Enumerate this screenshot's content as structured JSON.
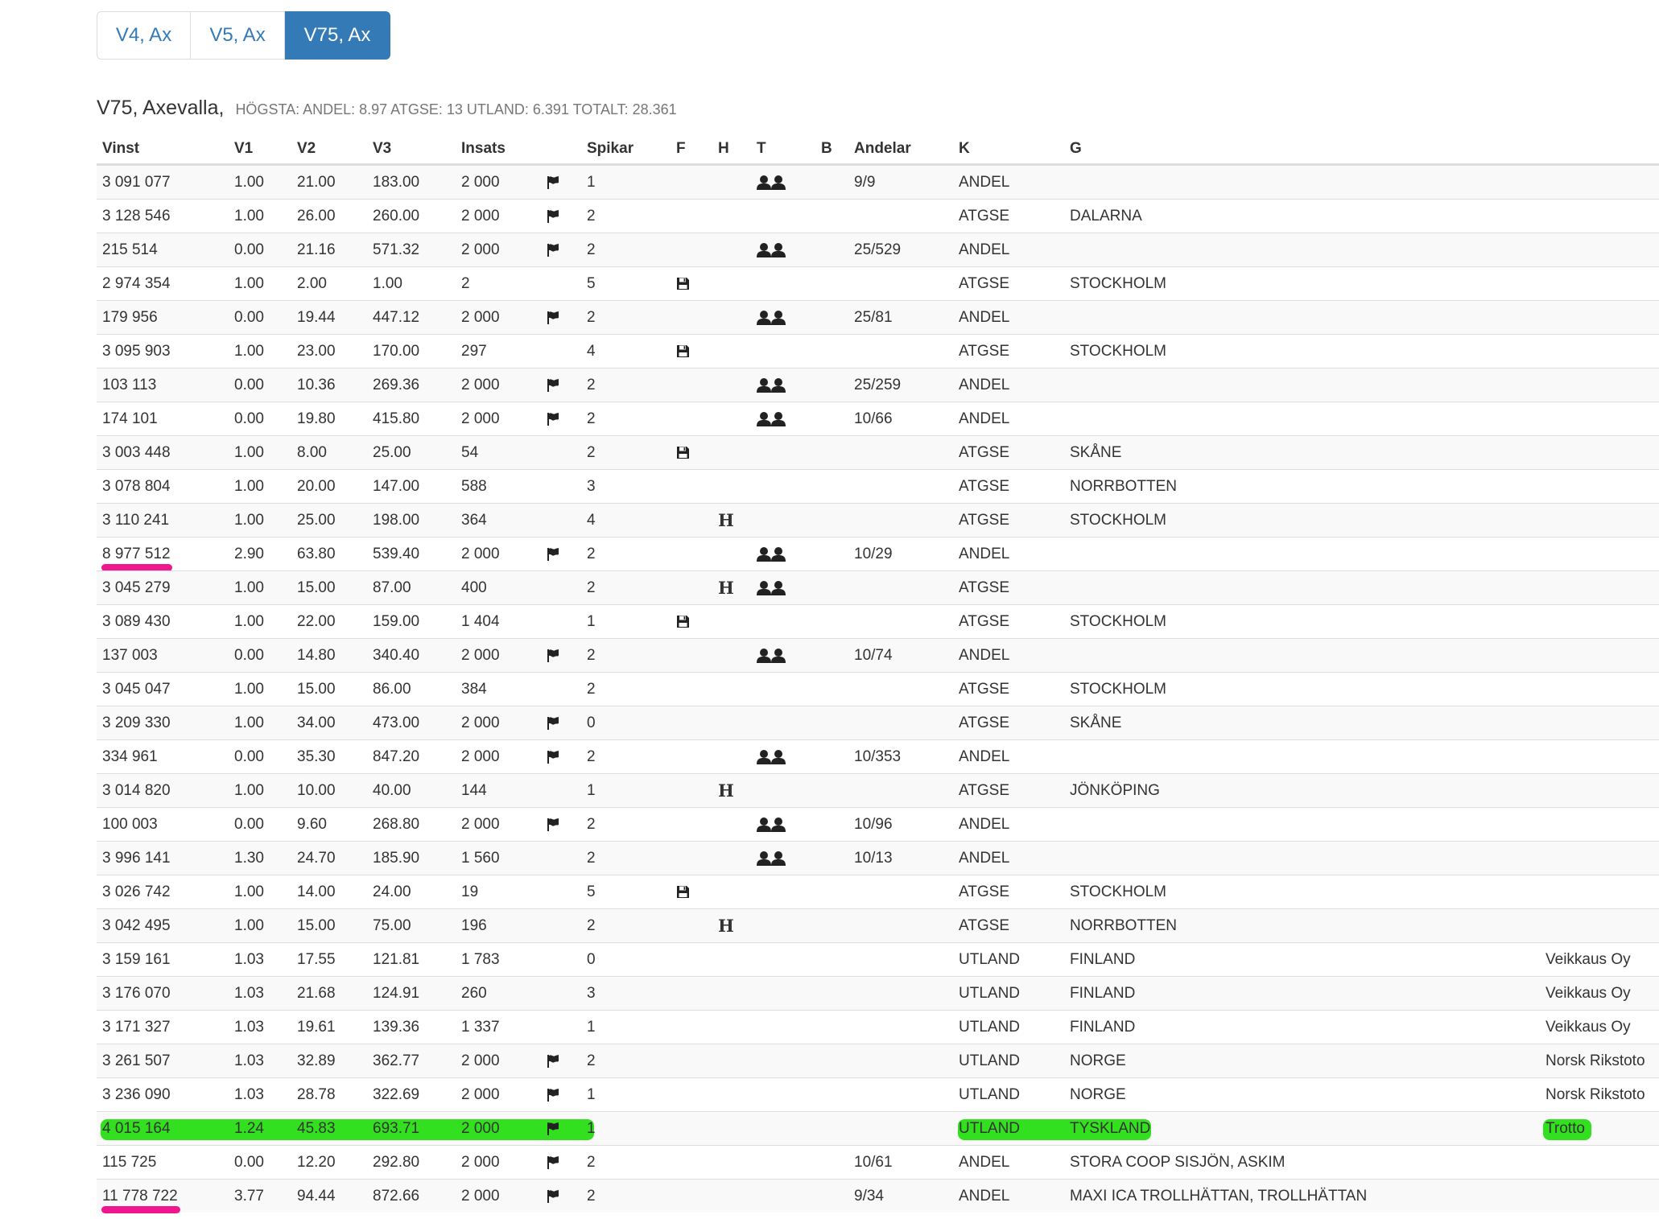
{
  "tabs": [
    {
      "label": "V4, Ax",
      "active": false
    },
    {
      "label": "V5, Ax",
      "active": false
    },
    {
      "label": "V75, Ax",
      "active": true
    }
  ],
  "heading": {
    "title": "V75, Axevalla,",
    "stats": "HÖGSTA:  ANDEL: 8.97  ATGSE: 13  UTLAND: 6.391  TOTALT: 28.361"
  },
  "columns": [
    "Vinst",
    "V1",
    "V2",
    "V3",
    "Insats",
    "Spikar",
    "F",
    "H",
    "T",
    "B",
    "Andelar",
    "K",
    "G"
  ],
  "rows": [
    {
      "vinst": "3 091 077",
      "v1": "1.00",
      "v2": "21.00",
      "v3": "183.00",
      "insats": "2 000",
      "flag": true,
      "spikar": "1",
      "f": false,
      "h": false,
      "t": true,
      "andelar": "9/9",
      "k": "ANDEL",
      "g": "",
      "ext": ""
    },
    {
      "vinst": "3 128 546",
      "v1": "1.00",
      "v2": "26.00",
      "v3": "260.00",
      "insats": "2 000",
      "flag": true,
      "spikar": "2",
      "f": false,
      "h": false,
      "t": false,
      "andelar": "",
      "k": "ATGSE",
      "g": "DALARNA",
      "ext": ""
    },
    {
      "vinst": "215 514",
      "v1": "0.00",
      "v2": "21.16",
      "v3": "571.32",
      "insats": "2 000",
      "flag": true,
      "spikar": "2",
      "f": false,
      "h": false,
      "t": true,
      "andelar": "25/529",
      "k": "ANDEL",
      "g": "",
      "ext": ""
    },
    {
      "vinst": "2 974 354",
      "v1": "1.00",
      "v2": "2.00",
      "v3": "1.00",
      "insats": "2",
      "flag": false,
      "spikar": "5",
      "f": true,
      "h": false,
      "t": false,
      "andelar": "",
      "k": "ATGSE",
      "g": "STOCKHOLM",
      "ext": ""
    },
    {
      "vinst": "179 956",
      "v1": "0.00",
      "v2": "19.44",
      "v3": "447.12",
      "insats": "2 000",
      "flag": true,
      "spikar": "2",
      "f": false,
      "h": false,
      "t": true,
      "andelar": "25/81",
      "k": "ANDEL",
      "g": "",
      "ext": ""
    },
    {
      "vinst": "3 095 903",
      "v1": "1.00",
      "v2": "23.00",
      "v3": "170.00",
      "insats": "297",
      "flag": false,
      "spikar": "4",
      "f": true,
      "h": false,
      "t": false,
      "andelar": "",
      "k": "ATGSE",
      "g": "STOCKHOLM",
      "ext": ""
    },
    {
      "vinst": "103 113",
      "v1": "0.00",
      "v2": "10.36",
      "v3": "269.36",
      "insats": "2 000",
      "flag": true,
      "spikar": "2",
      "f": false,
      "h": false,
      "t": true,
      "andelar": "25/259",
      "k": "ANDEL",
      "g": "",
      "ext": ""
    },
    {
      "vinst": "174 101",
      "v1": "0.00",
      "v2": "19.80",
      "v3": "415.80",
      "insats": "2 000",
      "flag": true,
      "spikar": "2",
      "f": false,
      "h": false,
      "t": true,
      "andelar": "10/66",
      "k": "ANDEL",
      "g": "",
      "ext": ""
    },
    {
      "vinst": "3 003 448",
      "v1": "1.00",
      "v2": "8.00",
      "v3": "25.00",
      "insats": "54",
      "flag": false,
      "spikar": "2",
      "f": true,
      "h": false,
      "t": false,
      "andelar": "",
      "k": "ATGSE",
      "g": "SKÅNE",
      "ext": ""
    },
    {
      "vinst": "3 078 804",
      "v1": "1.00",
      "v2": "20.00",
      "v3": "147.00",
      "insats": "588",
      "flag": false,
      "spikar": "3",
      "f": false,
      "h": false,
      "t": false,
      "andelar": "",
      "k": "ATGSE",
      "g": "NORRBOTTEN",
      "ext": ""
    },
    {
      "vinst": "3 110 241",
      "v1": "1.00",
      "v2": "25.00",
      "v3": "198.00",
      "insats": "364",
      "flag": false,
      "spikar": "4",
      "f": false,
      "h": true,
      "t": false,
      "andelar": "",
      "k": "ATGSE",
      "g": "STOCKHOLM",
      "ext": ""
    },
    {
      "vinst": "8 977 512",
      "v1": "2.90",
      "v2": "63.80",
      "v3": "539.40",
      "insats": "2 000",
      "flag": true,
      "spikar": "2",
      "f": false,
      "h": false,
      "t": true,
      "andelar": "10/29",
      "k": "ANDEL",
      "g": "",
      "ext": "",
      "pink": true
    },
    {
      "vinst": "3 045 279",
      "v1": "1.00",
      "v2": "15.00",
      "v3": "87.00",
      "insats": "400",
      "flag": false,
      "spikar": "2",
      "f": false,
      "h": true,
      "t": true,
      "andelar": "",
      "k": "ATGSE",
      "g": "",
      "ext": ""
    },
    {
      "vinst": "3 089 430",
      "v1": "1.00",
      "v2": "22.00",
      "v3": "159.00",
      "insats": "1 404",
      "flag": false,
      "spikar": "1",
      "f": true,
      "h": false,
      "t": false,
      "andelar": "",
      "k": "ATGSE",
      "g": "STOCKHOLM",
      "ext": ""
    },
    {
      "vinst": "137 003",
      "v1": "0.00",
      "v2": "14.80",
      "v3": "340.40",
      "insats": "2 000",
      "flag": true,
      "spikar": "2",
      "f": false,
      "h": false,
      "t": true,
      "andelar": "10/74",
      "k": "ANDEL",
      "g": "",
      "ext": ""
    },
    {
      "vinst": "3 045 047",
      "v1": "1.00",
      "v2": "15.00",
      "v3": "86.00",
      "insats": "384",
      "flag": false,
      "spikar": "2",
      "f": false,
      "h": false,
      "t": false,
      "andelar": "",
      "k": "ATGSE",
      "g": "STOCKHOLM",
      "ext": ""
    },
    {
      "vinst": "3 209 330",
      "v1": "1.00",
      "v2": "34.00",
      "v3": "473.00",
      "insats": "2 000",
      "flag": true,
      "spikar": "0",
      "f": false,
      "h": false,
      "t": false,
      "andelar": "",
      "k": "ATGSE",
      "g": "SKÅNE",
      "ext": ""
    },
    {
      "vinst": "334 961",
      "v1": "0.00",
      "v2": "35.30",
      "v3": "847.20",
      "insats": "2 000",
      "flag": true,
      "spikar": "2",
      "f": false,
      "h": false,
      "t": true,
      "andelar": "10/353",
      "k": "ANDEL",
      "g": "",
      "ext": ""
    },
    {
      "vinst": "3 014 820",
      "v1": "1.00",
      "v2": "10.00",
      "v3": "40.00",
      "insats": "144",
      "flag": false,
      "spikar": "1",
      "f": false,
      "h": true,
      "t": false,
      "andelar": "",
      "k": "ATGSE",
      "g": "JÖNKÖPING",
      "ext": ""
    },
    {
      "vinst": "100 003",
      "v1": "0.00",
      "v2": "9.60",
      "v3": "268.80",
      "insats": "2 000",
      "flag": true,
      "spikar": "2",
      "f": false,
      "h": false,
      "t": true,
      "andelar": "10/96",
      "k": "ANDEL",
      "g": "",
      "ext": ""
    },
    {
      "vinst": "3 996 141",
      "v1": "1.30",
      "v2": "24.70",
      "v3": "185.90",
      "insats": "1 560",
      "flag": false,
      "spikar": "2",
      "f": false,
      "h": false,
      "t": true,
      "andelar": "10/13",
      "k": "ANDEL",
      "g": "",
      "ext": ""
    },
    {
      "vinst": "3 026 742",
      "v1": "1.00",
      "v2": "14.00",
      "v3": "24.00",
      "insats": "19",
      "flag": false,
      "spikar": "5",
      "f": true,
      "h": false,
      "t": false,
      "andelar": "",
      "k": "ATGSE",
      "g": "STOCKHOLM",
      "ext": ""
    },
    {
      "vinst": "3 042 495",
      "v1": "1.00",
      "v2": "15.00",
      "v3": "75.00",
      "insats": "196",
      "flag": false,
      "spikar": "2",
      "f": false,
      "h": true,
      "t": false,
      "andelar": "",
      "k": "ATGSE",
      "g": "NORRBOTTEN",
      "ext": ""
    },
    {
      "vinst": "3 159 161",
      "v1": "1.03",
      "v2": "17.55",
      "v3": "121.81",
      "insats": "1 783",
      "flag": false,
      "spikar": "0",
      "f": false,
      "h": false,
      "t": false,
      "andelar": "",
      "k": "UTLAND",
      "g": "FINLAND",
      "ext": "Veikkaus Oy"
    },
    {
      "vinst": "3 176 070",
      "v1": "1.03",
      "v2": "21.68",
      "v3": "124.91",
      "insats": "260",
      "flag": false,
      "spikar": "3",
      "f": false,
      "h": false,
      "t": false,
      "andelar": "",
      "k": "UTLAND",
      "g": "FINLAND",
      "ext": "Veikkaus Oy"
    },
    {
      "vinst": "3 171 327",
      "v1": "1.03",
      "v2": "19.61",
      "v3": "139.36",
      "insats": "1 337",
      "flag": false,
      "spikar": "1",
      "f": false,
      "h": false,
      "t": false,
      "andelar": "",
      "k": "UTLAND",
      "g": "FINLAND",
      "ext": "Veikkaus Oy"
    },
    {
      "vinst": "3 261 507",
      "v1": "1.03",
      "v2": "32.89",
      "v3": "362.77",
      "insats": "2 000",
      "flag": true,
      "spikar": "2",
      "f": false,
      "h": false,
      "t": false,
      "andelar": "",
      "k": "UTLAND",
      "g": "NORGE",
      "ext": "Norsk Rikstoto"
    },
    {
      "vinst": "3 236 090",
      "v1": "1.03",
      "v2": "28.78",
      "v3": "322.69",
      "insats": "2 000",
      "flag": true,
      "spikar": "1",
      "f": false,
      "h": false,
      "t": false,
      "andelar": "",
      "k": "UTLAND",
      "g": "NORGE",
      "ext": "Norsk Rikstoto"
    },
    {
      "vinst": "4 015 164",
      "v1": "1.24",
      "v2": "45.83",
      "v3": "693.71",
      "insats": "2 000",
      "flag": true,
      "spikar": "1",
      "f": false,
      "h": false,
      "t": false,
      "andelar": "",
      "k": "UTLAND",
      "g": "TYSKLAND",
      "ext": "Trotto",
      "green": true
    },
    {
      "vinst": "115 725",
      "v1": "0.00",
      "v2": "12.20",
      "v3": "292.80",
      "insats": "2 000",
      "flag": true,
      "spikar": "2",
      "f": false,
      "h": false,
      "t": false,
      "andelar": "10/61",
      "k": "ANDEL",
      "g": "STORA COOP SISJÖN, ASKIM",
      "ext": ""
    },
    {
      "vinst": "11 778 722",
      "v1": "3.77",
      "v2": "94.44",
      "v3": "872.66",
      "insats": "2 000",
      "flag": true,
      "spikar": "2",
      "f": false,
      "h": false,
      "t": false,
      "andelar": "9/34",
      "k": "ANDEL",
      "g": "MAXI ICA TROLLHÄTTAN, TROLLHÄTTAN",
      "ext": "",
      "pink": true
    }
  ]
}
